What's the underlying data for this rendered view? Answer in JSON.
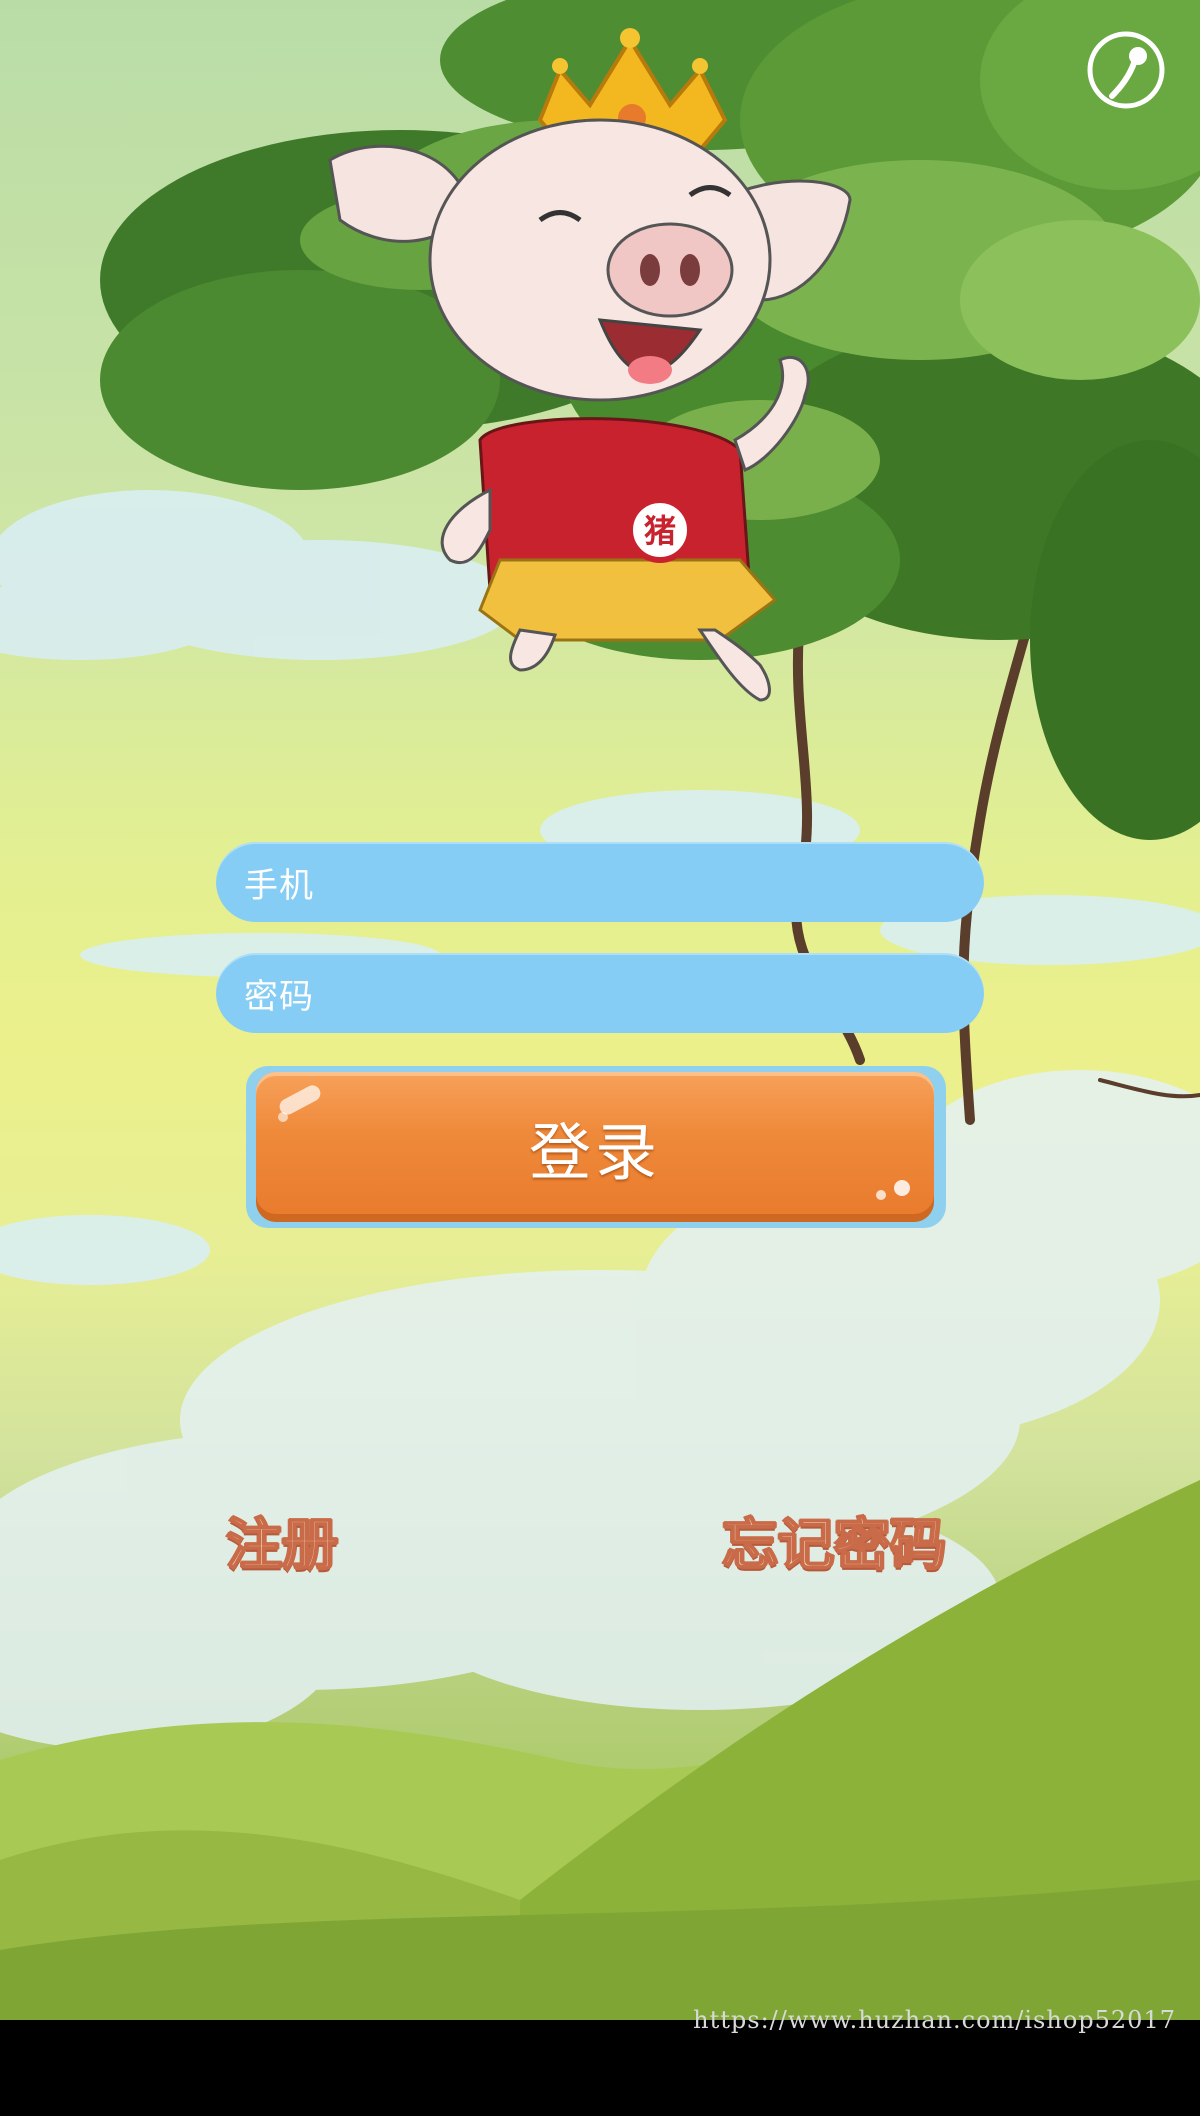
{
  "login_form": {
    "phone_placeholder": "手机",
    "password_placeholder": "密码",
    "login_button_label": "登录"
  },
  "links": {
    "register": "注册",
    "forgot_password": "忘记密码"
  },
  "mascot": {
    "badge_character": "猪"
  },
  "watermark": "https://www.huzhan.com/ishop52017",
  "colors": {
    "input_background": "#85cdf4",
    "login_button": "#ef8a3b",
    "link_text": "#f3e7c9",
    "link_outline": "#c96a48"
  },
  "icons": {
    "top_right": "help-icon"
  }
}
